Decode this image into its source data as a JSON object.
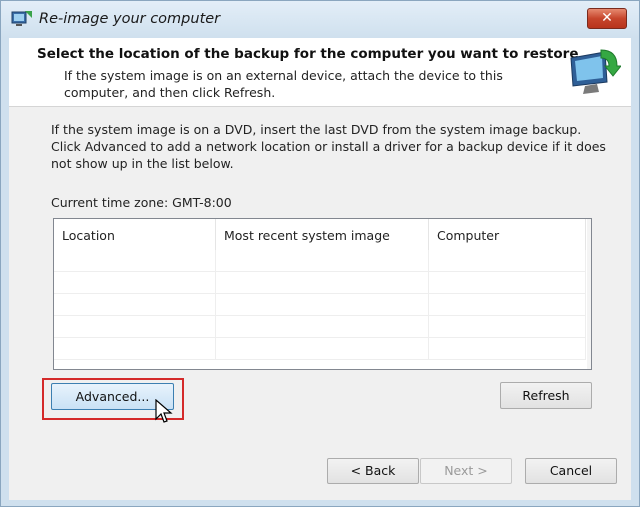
{
  "window": {
    "title": "Re-image your computer",
    "close_label": "✕"
  },
  "header": {
    "title": "Select the location of the backup for the computer you want to restore",
    "description": "If the system image is on an external device, attach the device to this computer, and then click Refresh."
  },
  "body": {
    "instructions": "If the system image is on a DVD, insert the last DVD from the system image backup. Click Advanced to add a network location or install a driver for a backup device if it does not show up in the list below.",
    "timezone": "Current time zone: GMT-8:00"
  },
  "list": {
    "columns": [
      "Location",
      "Most recent system image",
      "Computer"
    ],
    "rows": []
  },
  "buttons": {
    "advanced": "Advanced...",
    "refresh": "Refresh",
    "back": "< Back",
    "next": "Next >",
    "cancel": "Cancel"
  },
  "icons": {
    "app": "backup-restore-icon",
    "header": "monitor-restore-icon",
    "cursor": "mouse-pointer-icon"
  },
  "colors": {
    "highlight": "#d42a2a",
    "title_bar": "#cfe0ee",
    "close_button": "#c6452c"
  }
}
